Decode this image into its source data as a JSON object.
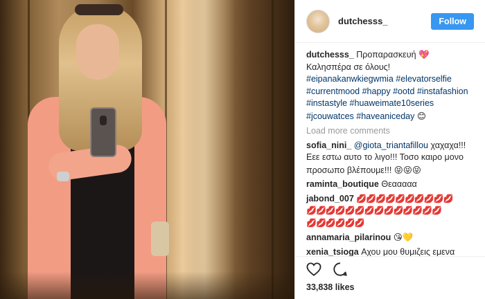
{
  "post": {
    "username": "dutchesss_",
    "follow_label": "Follow",
    "caption": {
      "username": "dutchesss_",
      "line1": "Προπαρασκευή",
      "line1_emoji": "💖",
      "line2": "Καλησπέρα σε όλους!",
      "hashtags": [
        "#eipanakanwkiegwmia",
        "#elevatorselfie",
        "#currentmood",
        "#happy",
        "#ootd",
        "#instafashion",
        "#instastyle",
        "#huaweimate10series",
        "#jcouwatces",
        "#haveaniceday"
      ],
      "end_emoji": "😊"
    },
    "load_more_label": "Load more comments",
    "comments": [
      {
        "username": "sofia_nini_",
        "mention": "@giota_triantafillou",
        "text": "χαχαχα!!! Εεε εστω αυτο το λιγο!!! Τοσο καιρο μονο προσωπο βλέπουμε!!!",
        "emoji": "😝😝😝"
      },
      {
        "username": "raminta_boutique",
        "text": "Θεααααα"
      },
      {
        "username": "jabond_007",
        "emoji_line1": "💋💋💋💋💋💋💋💋💋💋",
        "emoji_line2": "💋💋💋💋💋💋💋💋💋💋💋💋💋💋",
        "emoji_line3": "💋💋💋💋💋💋"
      },
      {
        "username": "annamaria_pilarinou",
        "emoji": "😘💛"
      },
      {
        "username": "xenia_tsioga",
        "text": "Αχου μου θυμιζεις εμενα δουκισα με την κοιλιτσα κ τωρα εχω τον μπο"
      }
    ],
    "likes_label": "33,838 likes",
    "icons": [
      "heart-icon",
      "comment-icon"
    ],
    "colors": {
      "follow_button": "#3897f0",
      "hashtag": "#003569",
      "muted": "#999999"
    }
  }
}
